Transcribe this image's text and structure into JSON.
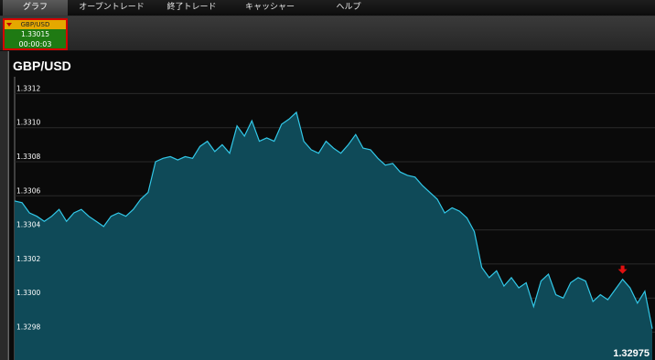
{
  "nav": {
    "tabs": [
      {
        "label": "グラフ"
      },
      {
        "label": "オープントレード"
      },
      {
        "label": "終了トレード"
      },
      {
        "label": "キャッシャー"
      },
      {
        "label": "ヘルプ"
      }
    ]
  },
  "ticket": {
    "symbol": "GBP/USD",
    "price": "1.33015",
    "timer": "00:00:03",
    "direction": "down",
    "header_color": "#e5a800",
    "body_color": "#1f7a13",
    "border_color": "#d40000"
  },
  "chart": {
    "title": "GBP/USD",
    "last_price_label": "1.32975"
  },
  "chart_data": {
    "type": "area",
    "title": "GBP/USD",
    "line_color": "#32c8e8",
    "fill_color": "#0f4a58",
    "grid": true,
    "ylim": [
      1.3297,
      1.3313
    ],
    "y_ticks": [
      "1.3312",
      "1.3310",
      "1.3308",
      "1.3306",
      "1.3304",
      "1.3302",
      "1.3300",
      "1.3298"
    ],
    "marker": {
      "type": "down-arrow",
      "color": "#e01010",
      "point_index": 82
    },
    "values": [
      1.33057,
      1.33056,
      1.3305,
      1.33048,
      1.33045,
      1.33048,
      1.33052,
      1.33045,
      1.3305,
      1.33052,
      1.33048,
      1.33045,
      1.33042,
      1.33048,
      1.3305,
      1.33048,
      1.33052,
      1.33058,
      1.33062,
      1.3308,
      1.33082,
      1.33083,
      1.33081,
      1.33083,
      1.33082,
      1.33089,
      1.33092,
      1.33086,
      1.3309,
      1.33085,
      1.33101,
      1.33095,
      1.33104,
      1.33092,
      1.33094,
      1.33092,
      1.33102,
      1.33105,
      1.33109,
      1.33092,
      1.33087,
      1.33085,
      1.33092,
      1.33088,
      1.33085,
      1.3309,
      1.33096,
      1.33088,
      1.33087,
      1.33082,
      1.33078,
      1.33079,
      1.33074,
      1.33072,
      1.33071,
      1.33066,
      1.33062,
      1.33058,
      1.3305,
      1.33053,
      1.33051,
      1.33047,
      1.33039,
      1.33018,
      1.33012,
      1.33016,
      1.33007,
      1.33012,
      1.33006,
      1.33009,
      1.32995,
      1.3301,
      1.33014,
      1.33002,
      1.33,
      1.33009,
      1.33012,
      1.3301,
      1.32998,
      1.33002,
      1.32999,
      1.33005,
      1.33011,
      1.33006,
      1.32997,
      1.33004,
      1.32982
    ]
  }
}
